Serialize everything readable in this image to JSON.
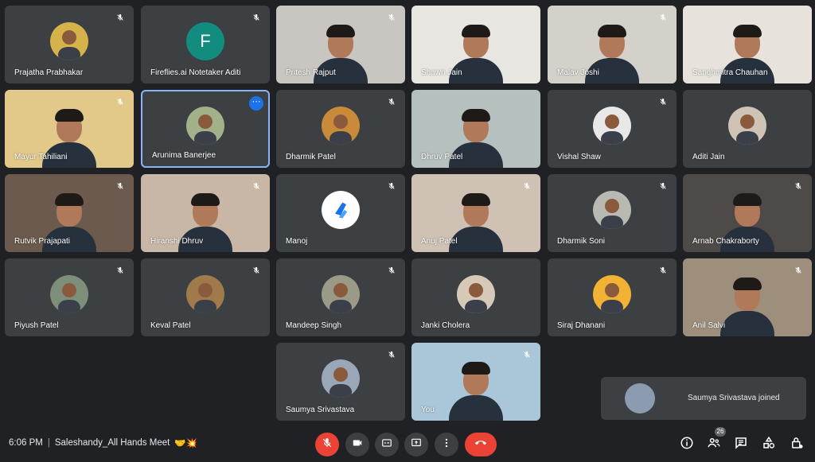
{
  "participants": [
    {
      "name": "Prajatha Prabhakar",
      "muted": true,
      "type": "avatar",
      "avatar_color": "#d6b24a"
    },
    {
      "name": "Fireflies.ai Notetaker Aditi",
      "muted": true,
      "type": "letter",
      "letter": "F"
    },
    {
      "name": "Pritesh Rajput",
      "muted": true,
      "type": "video",
      "bg": "#c9c6c2"
    },
    {
      "name": "Shawn Jain",
      "muted": false,
      "type": "video",
      "bg": "#e8e6e1"
    },
    {
      "name": "Malav Joshi",
      "muted": true,
      "type": "video",
      "bg": "#d4d1cb"
    },
    {
      "name": "Sanghmitra Chauhan",
      "muted": false,
      "type": "video",
      "bg": "#e7e3dc"
    },
    {
      "name": "Mayur Tahiliani",
      "muted": true,
      "type": "video",
      "bg": "#e2c98a"
    },
    {
      "name": "Arunima Banerjee",
      "muted": false,
      "type": "avatar",
      "avatar_color": "#a3b18a",
      "active": true
    },
    {
      "name": "Dharmik Patel",
      "muted": true,
      "type": "avatar",
      "avatar_color": "#c98b3a"
    },
    {
      "name": "Dhruv Patel",
      "muted": false,
      "type": "video",
      "bg": "#b6c1bf"
    },
    {
      "name": "Vishal Shaw",
      "muted": true,
      "type": "avatar",
      "avatar_color": "#e8e8e8"
    },
    {
      "name": "Aditi Jain",
      "muted": false,
      "type": "avatar",
      "avatar_color": "#cfc3b6"
    },
    {
      "name": "Rutvik Prajapati",
      "muted": true,
      "type": "video",
      "bg": "#6b5a4d"
    },
    {
      "name": "Hiranshi Dhruv",
      "muted": true,
      "type": "video",
      "bg": "#c8b7a6"
    },
    {
      "name": "Manoj",
      "muted": true,
      "type": "logo"
    },
    {
      "name": "Anuj Patel",
      "muted": true,
      "type": "video",
      "bg": "#cfc2b4"
    },
    {
      "name": "Dharmik Soni",
      "muted": true,
      "type": "avatar",
      "avatar_color": "#b9b9b3"
    },
    {
      "name": "Arnab Chakraborty",
      "muted": true,
      "type": "video",
      "bg": "#4e4a48"
    },
    {
      "name": "Piyush Patel",
      "muted": true,
      "type": "avatar",
      "avatar_color": "#7d8e7a"
    },
    {
      "name": "Keval Patel",
      "muted": true,
      "type": "avatar",
      "avatar_color": "#a07a4a"
    },
    {
      "name": "Mandeep Singh",
      "muted": true,
      "type": "avatar",
      "avatar_color": "#9a9a86"
    },
    {
      "name": "Janki Cholera",
      "muted": false,
      "type": "avatar",
      "avatar_color": "#d7c9b8"
    },
    {
      "name": "Siraj Dhanani",
      "muted": true,
      "type": "avatar",
      "avatar_color": "#f2b233"
    },
    {
      "name": "Anil Salvi",
      "muted": true,
      "type": "video",
      "bg": "#9e8f7d"
    },
    {
      "name": "Saumya Srivastava",
      "muted": true,
      "type": "avatar",
      "avatar_color": "#9aa7b8"
    },
    {
      "name": "You",
      "muted": true,
      "type": "video",
      "bg": "#a9c7d9"
    }
  ],
  "toast": {
    "text": "Saumya Srivastava joined"
  },
  "bottom_bar": {
    "time": "6:06 PM",
    "separator": "|",
    "meeting_title": "Saleshandy_All Hands Meet",
    "meeting_emoji": "🤝💥",
    "people_count": "26"
  },
  "colors": {
    "background": "#202124",
    "tile": "#3c4043",
    "accent_blue": "#8ab4f8",
    "end_call_red": "#ea4335"
  },
  "icons": {
    "mic_off": "mic-off-icon",
    "camera": "camera-icon",
    "captions": "captions-icon",
    "present": "present-icon",
    "more": "more-vert-icon",
    "end_call": "end-call-icon",
    "info": "info-icon",
    "people": "people-icon",
    "chat": "chat-icon",
    "activities": "activities-icon",
    "host_controls": "host-controls-icon"
  }
}
